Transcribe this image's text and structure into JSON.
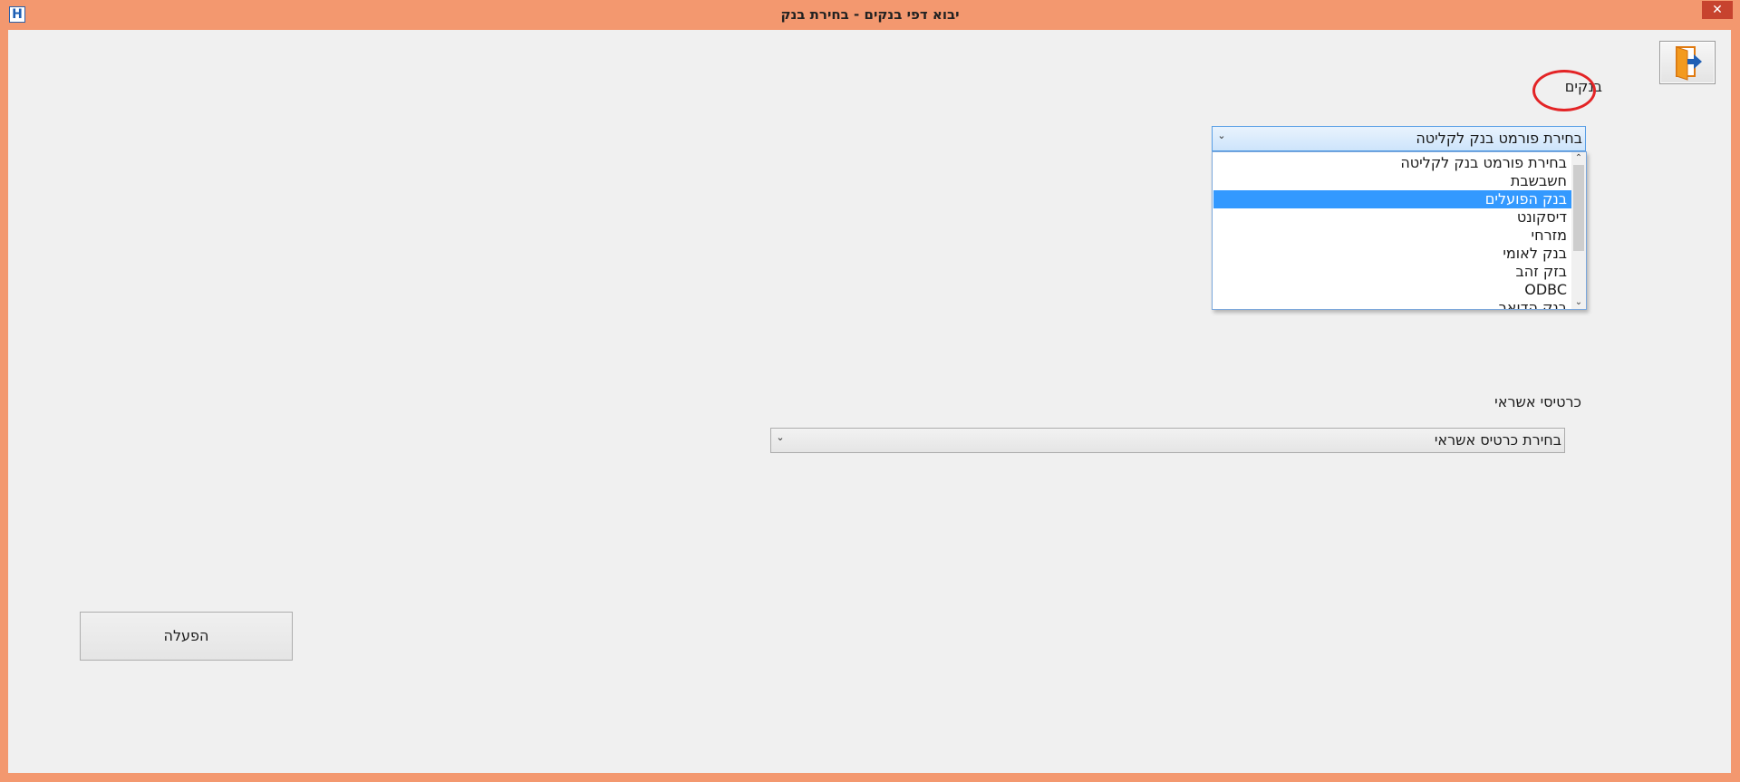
{
  "window": {
    "title": "יבוא דפי בנקים - בחירת בנק",
    "app_icon_letter": "H",
    "close_glyph": "✕"
  },
  "banks": {
    "label": "בנקים",
    "selected": "בחירת פורמט בנק לקליטה",
    "options": [
      "בחירת פורמט בנק לקליטה",
      "חשבשבת",
      "בנק הפועלים",
      "דיסקונט",
      "מזרחי",
      "בנק לאומי",
      "בזק זהב",
      "ODBC",
      "בנק הדואר"
    ],
    "highlighted_index": 2,
    "annotation_color": "#e32426"
  },
  "credit_cards": {
    "label": "כרטיסי אשראי",
    "selected": "בחירת כרטיס אשראי"
  },
  "run_button": {
    "label": "הפעלה"
  },
  "exit_button": {
    "icon": "exit-door-icon"
  },
  "colors": {
    "frame": "#f3986f",
    "selection": "#3399ff",
    "client_bg": "#f0f0f0"
  }
}
